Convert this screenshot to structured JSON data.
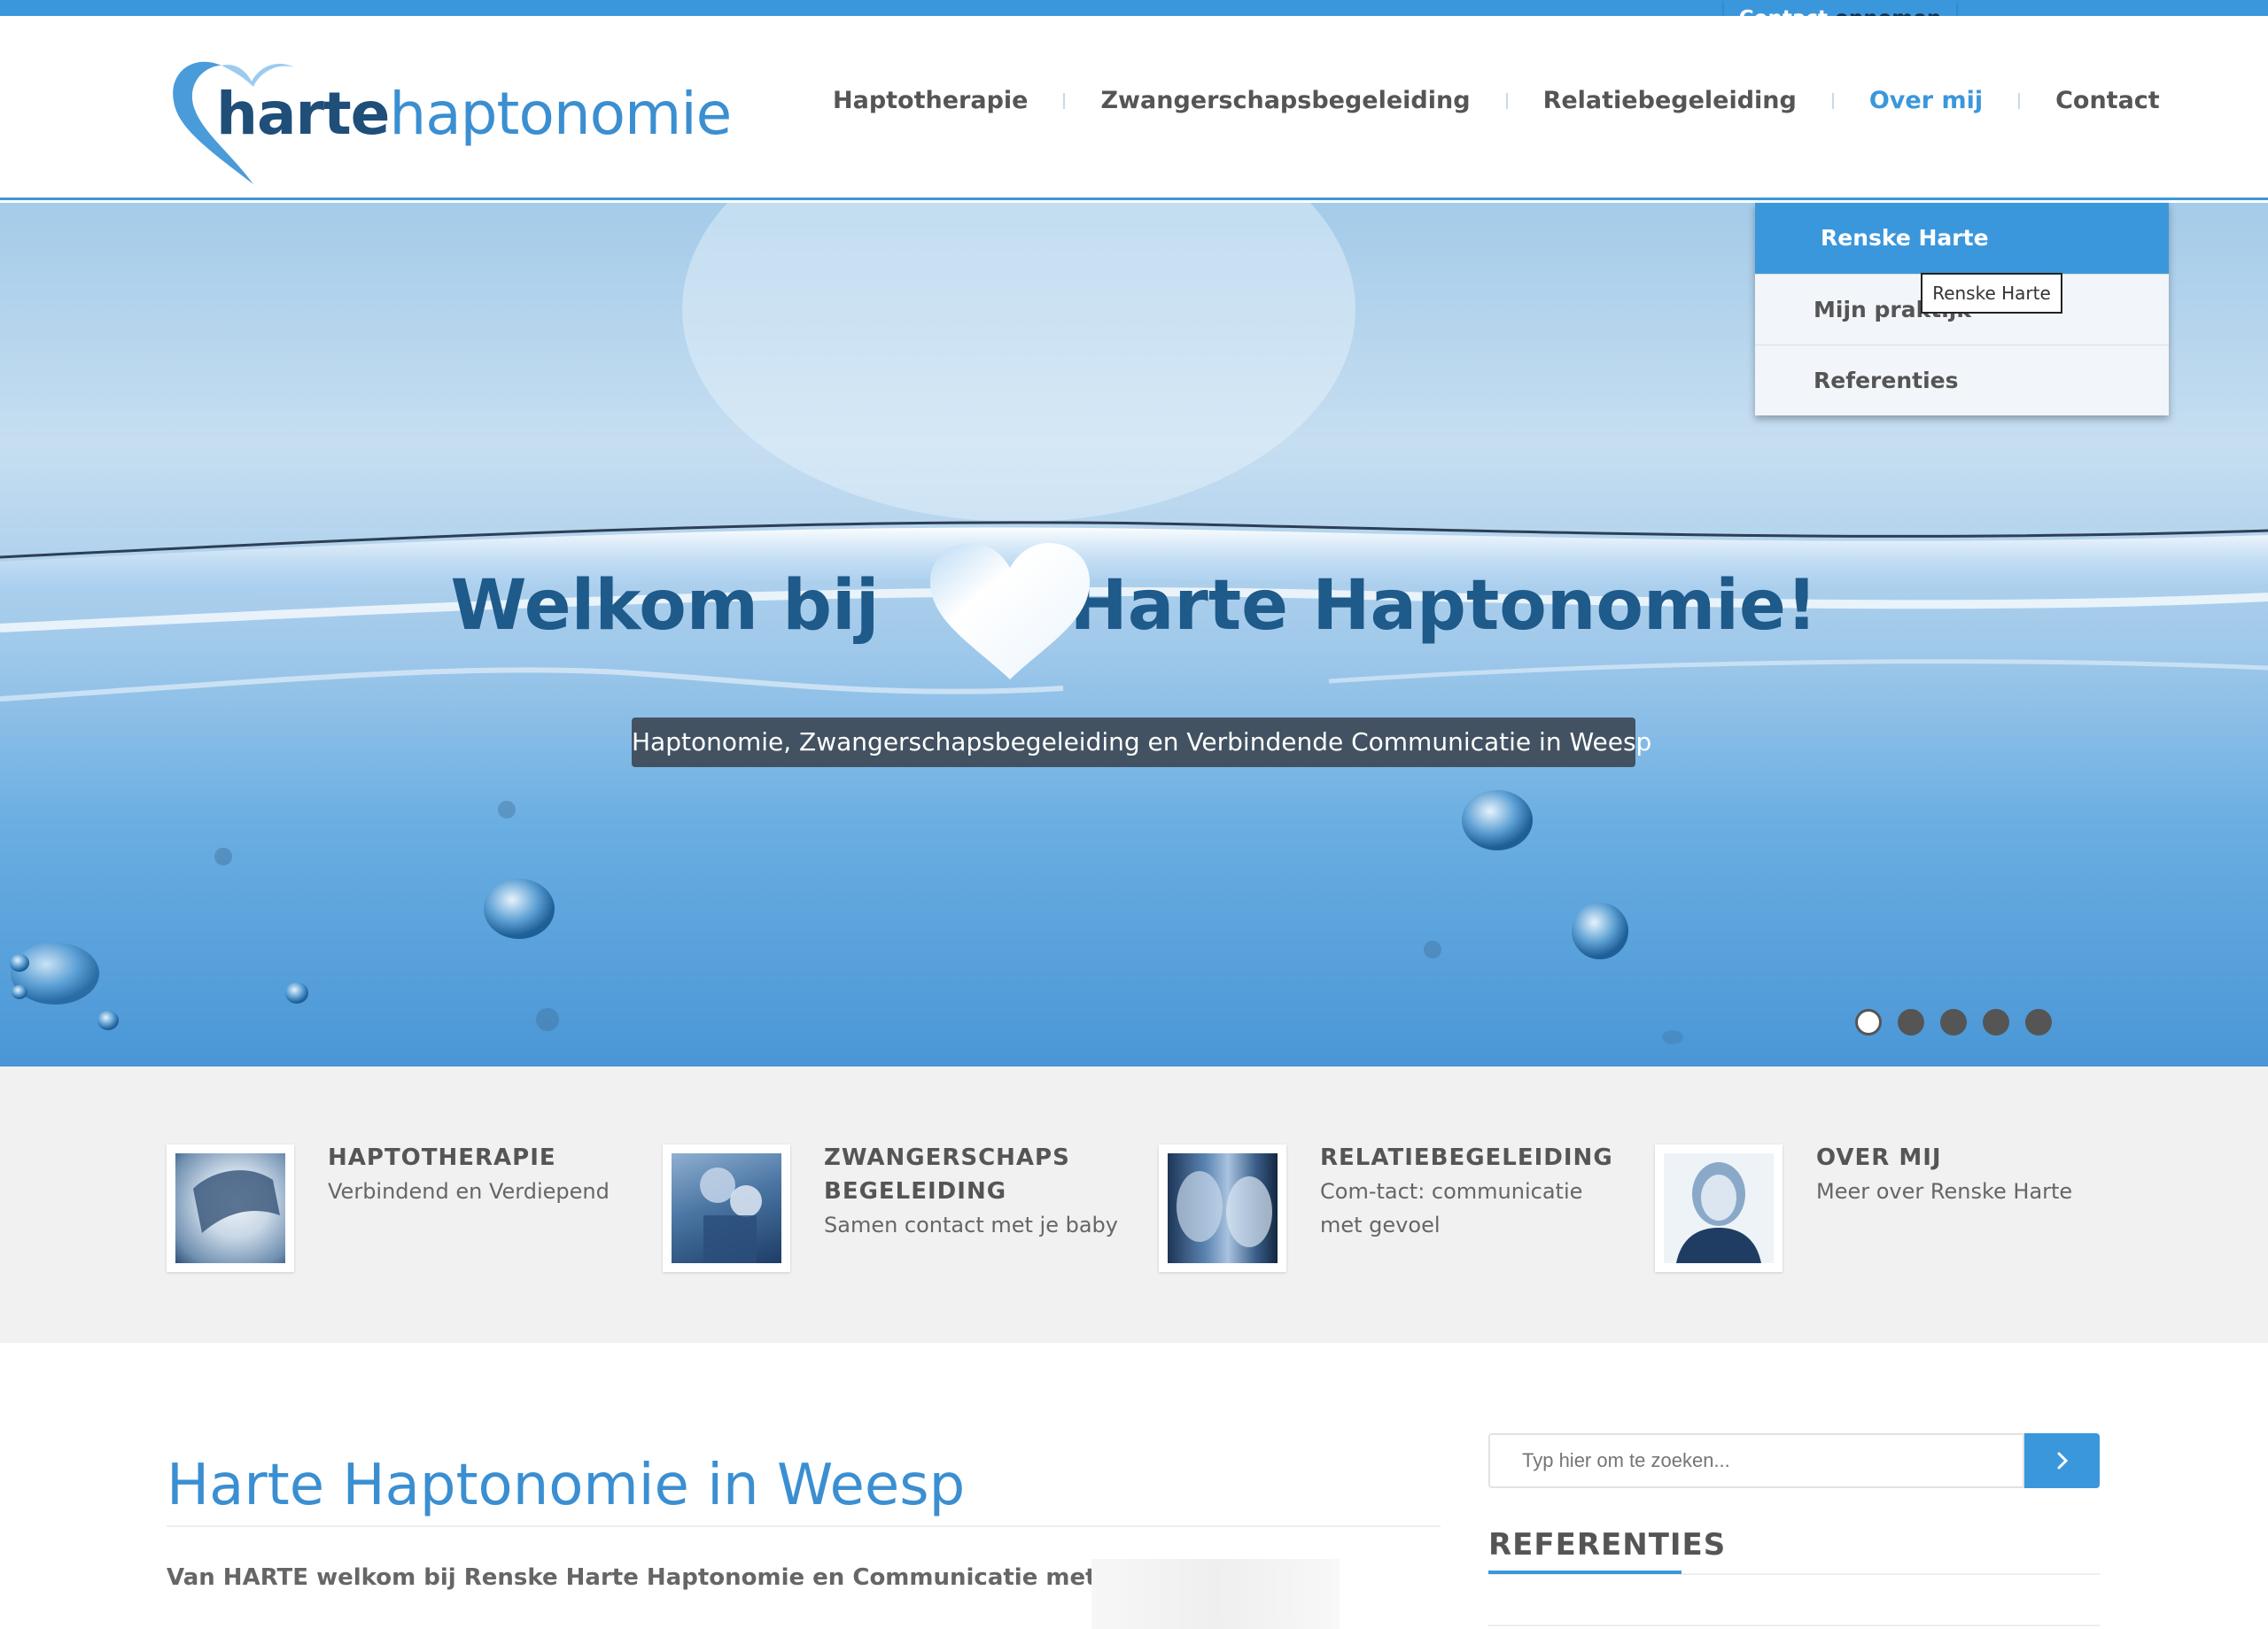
{
  "top_bar": {
    "contact_word1": "Contact",
    "contact_word2": "opnemen"
  },
  "logo": {
    "bold": "harte",
    "light": "haptonomie"
  },
  "nav": {
    "items": [
      {
        "label": "Haptotherapie"
      },
      {
        "label": "Zwangerschapsbegeleiding"
      },
      {
        "label": "Relatiebegeleiding"
      },
      {
        "label": "Over mij",
        "active": true
      },
      {
        "label": "Contact"
      }
    ]
  },
  "dropdown": {
    "items": [
      {
        "label": "Renske Harte",
        "active": true
      },
      {
        "label": "Mijn praktijk"
      },
      {
        "label": "Referenties"
      }
    ],
    "tooltip": "Renske Harte"
  },
  "hero": {
    "title_left": "Welkom bij",
    "title_right": "Harte Haptonomie!",
    "subtitle": "Haptonomie, Zwangerschapsbegeleiding en Verbindende Communicatie in Weesp",
    "slide_count": 5,
    "active_slide": 1
  },
  "features": [
    {
      "title": "HAPTOTHERAPIE",
      "subtitle": "Verbindend en Verdiepend"
    },
    {
      "title": "ZWANGERSCHAPS BEGELEIDING",
      "subtitle": "Samen contact met je baby"
    },
    {
      "title": "RELATIEBEGELEIDING",
      "subtitle": "Com-tact: communicatie met gevoel"
    },
    {
      "title": "OVER MIJ",
      "subtitle": "Meer over Renske Harte"
    }
  ],
  "main": {
    "title": "Harte Haptonomie in Weesp",
    "intro": "Van HARTE welkom bij Renske Harte Haptonomie en Communicatie met gevoel"
  },
  "sidebar": {
    "search_placeholder": "Typ hier om te zoeken...",
    "section_title": "REFERENTIES"
  },
  "colors": {
    "accent": "#3b97dc",
    "title_blue": "#3b8fd1",
    "navy": "#1e5a8a",
    "text": "#555555",
    "strip_bg": "#f1f1f1"
  },
  "icons": [
    "heart-logo-icon",
    "heart-icon",
    "chevron-right-icon"
  ]
}
